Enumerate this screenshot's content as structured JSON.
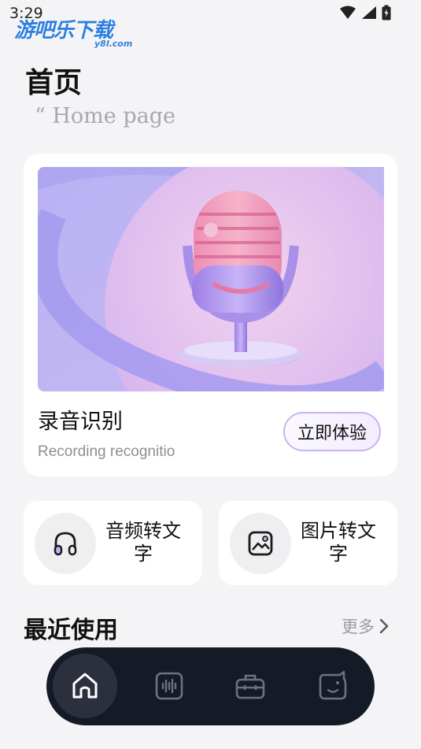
{
  "status_bar": {
    "time": "3:29"
  },
  "watermark": {
    "main": "游吧乐下载",
    "sub": "y8l.com"
  },
  "header": {
    "title": "首页",
    "subtitle": "“ Home page"
  },
  "hero": {
    "title": "录音识别",
    "subtitle": "Recording recognitio",
    "button_label": "立即体验"
  },
  "features": [
    {
      "label": "音频转文字",
      "icon": "headphones-icon"
    },
    {
      "label": "图片转文字",
      "icon": "image-icon"
    }
  ],
  "recent": {
    "title": "最近使用",
    "more_label": "更多"
  },
  "tabs": [
    {
      "icon": "home-icon",
      "active": true
    },
    {
      "icon": "waveform-icon",
      "active": false
    },
    {
      "icon": "toolbox-icon",
      "active": false
    },
    {
      "icon": "smile-face-icon",
      "active": false
    }
  ],
  "colors": {
    "accent": "#c9b3f0",
    "tab_bar": "#151a27",
    "background": "#f4f4f6",
    "watermark": "#2e7fe0"
  }
}
